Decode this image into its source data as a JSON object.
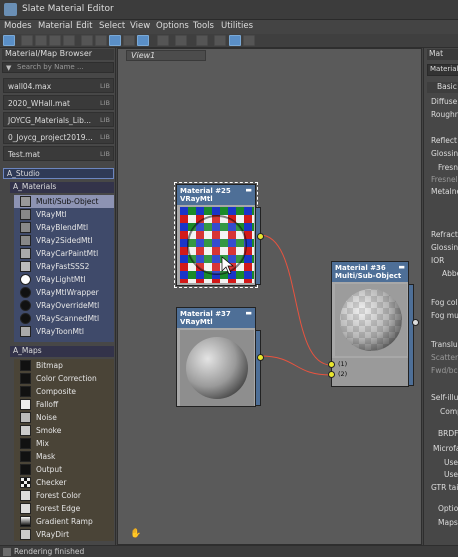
{
  "window": {
    "title": "Slate Material Editor"
  },
  "menu": [
    "Modes",
    "Material",
    "Edit",
    "Select",
    "View",
    "Options",
    "Tools",
    "Utilities"
  ],
  "browser": {
    "title": "Material/Map Browser",
    "search_placeholder": "Search by Name ...",
    "libraries": [
      {
        "name": "wall04.max",
        "tag": "LIB"
      },
      {
        "name": "2020_WHall.mat",
        "tag": "LIB"
      },
      {
        "name": "JOYCG_Materials_Lib...",
        "tag": "LIB"
      },
      {
        "name": "0_Joycg_project2019...",
        "tag": "LIB"
      },
      {
        "name": "Test.mat",
        "tag": "LIB"
      }
    ],
    "group": "A_Studio",
    "materials_group": "A_Materials",
    "materials": [
      "Multi/Sub-Object",
      "VRayMtl",
      "VRayBlendMtl",
      "VRay2SidedMtl",
      "VRayCarPaintMtl",
      "VRayFastSSS2",
      "VRayLightMtl",
      "VRayMtlWrapper",
      "VRayOverrideMtl",
      "VRayScannedMtl",
      "VRayToonMtl"
    ],
    "maps_group": "A_Maps",
    "maps": [
      "Bitmap",
      "Color Correction",
      "Composite",
      "Falloff",
      "Noise",
      "Smoke",
      "Mix",
      "Mask",
      "Output",
      "Checker",
      "Forest Color",
      "Forest Edge",
      "Gradient Ramp",
      "VRayDirt"
    ]
  },
  "view": {
    "tab": "View1"
  },
  "nodes": {
    "n25": {
      "name": "Material #25",
      "type": "VRayMtl"
    },
    "n37": {
      "name": "Material #37",
      "type": "VRayMtl"
    },
    "n36": {
      "name": "Material #36",
      "type": "Multi/Sub-Object",
      "slots": [
        "(1)",
        "(2)"
      ]
    }
  },
  "props": {
    "title": "Mat",
    "title_field": "Material",
    "section": "Basic",
    "labels": [
      "Diffuse",
      "Roughne",
      "Reflect",
      "Glossine",
      "Fresn",
      "Fresnel",
      "Metalnes",
      "Refract",
      "Glossine",
      "IOR",
      "Abbe",
      "Fog colo",
      "Fog mult",
      "Transluc",
      "Scatter",
      "Fwd/bck",
      "Self-illum",
      "Comp",
      "BRDF",
      "Microfa",
      "Use",
      "Use",
      "GTR tail",
      "Optio",
      "Maps"
    ]
  },
  "status": {
    "text": "Rendering finished"
  }
}
